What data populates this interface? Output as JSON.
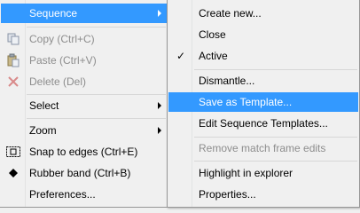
{
  "left_menu": {
    "items": [
      {
        "label": "Sequence",
        "state": "highlight",
        "submenu": true
      },
      {
        "label": "Copy (Ctrl+C)",
        "state": "disabled",
        "icon": "copy-icon"
      },
      {
        "label": "Paste (Ctrl+V)",
        "state": "disabled",
        "icon": "paste-icon"
      },
      {
        "label": "Delete (Del)",
        "state": "disabled",
        "icon": "delete-icon"
      },
      {
        "label": "Select",
        "state": "normal",
        "submenu": true
      },
      {
        "label": "Zoom",
        "state": "normal",
        "submenu": true
      },
      {
        "label": "Snap to edges (Ctrl+E)",
        "state": "normal",
        "icon": "snap-edges-icon"
      },
      {
        "label": "Rubber band (Ctrl+B)",
        "state": "normal",
        "icon": "rubber-band-icon"
      },
      {
        "label": "Preferences...",
        "state": "normal"
      }
    ]
  },
  "right_menu": {
    "items": [
      {
        "label": "Create new...",
        "state": "normal"
      },
      {
        "label": "Close",
        "state": "normal"
      },
      {
        "label": "Active",
        "state": "normal",
        "checked": true,
        "check_glyph": "✓"
      },
      {
        "label": "Dismantle...",
        "state": "normal"
      },
      {
        "label": "Save as Template...",
        "state": "highlight"
      },
      {
        "label": "Edit Sequence Templates...",
        "state": "normal"
      },
      {
        "label": "Remove match frame edits",
        "state": "disabled"
      },
      {
        "label": "Highlight in explorer",
        "state": "normal"
      },
      {
        "label": "Properties...",
        "state": "normal"
      }
    ]
  },
  "colors": {
    "highlight": "#3399ff",
    "disabled_text": "#8d8d8d",
    "menu_bg": "#f0f0f0"
  }
}
